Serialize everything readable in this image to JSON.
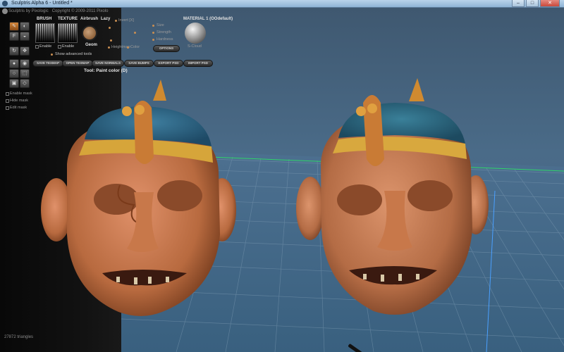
{
  "window": {
    "title": "Sculptris Alpha 6 - Untitled *",
    "buttons": {
      "minimize": "–",
      "maximize": "□",
      "close": "✕"
    }
  },
  "header": {
    "app_name": "Sculptris by Pixologic",
    "copyright": "Copyright © 2009-2011 Pixolo"
  },
  "tools": {
    "row1": [
      "paint-brush-icon",
      "airbrush-icon"
    ],
    "row2": [
      "flat-icon",
      "bump-icon"
    ],
    "row3": [
      "rotate-icon",
      "move-icon"
    ],
    "row4": [
      "grab-icon",
      "pinch-icon"
    ],
    "row5": [
      "smooth-icon",
      "scale-icon"
    ],
    "row6": [
      "mask-icon",
      "reduce-icon"
    ]
  },
  "brush": {
    "label": "BRUSH",
    "enable": "Enable"
  },
  "texture": {
    "label": "TEXTURE",
    "enable": "Enable"
  },
  "airbrush": "Airbrush",
  "lazy": "Lazy",
  "geom": "Geom",
  "invert": "Invert [X]",
  "size": "Size",
  "strength": "Strength",
  "hardness": "Hardness",
  "heightmap": "Heightmap",
  "color": "Color",
  "options": "OPTIONS",
  "material": {
    "label": "MATERIAL 1 (OOdefault)",
    "caption": "S-Cloud"
  },
  "show_advanced": "Show advanced tools",
  "buttons": [
    "SAVE TEXMAP",
    "OPEN TEXMAP",
    "SAVE NORMALS",
    "SAVE BUMPS",
    "EXPORT PSD",
    "IMPORT PSD"
  ],
  "tool_status": "Tool: Paint color (D)",
  "mask_options": [
    "Enable mask",
    "Hide mask",
    "Edit mask"
  ],
  "status": {
    "triangles": "27872 triangles"
  },
  "colors": {
    "accent": "#d6893c",
    "viewport_bg": "#4a6b88",
    "grid_line": "#6f8ea6"
  }
}
